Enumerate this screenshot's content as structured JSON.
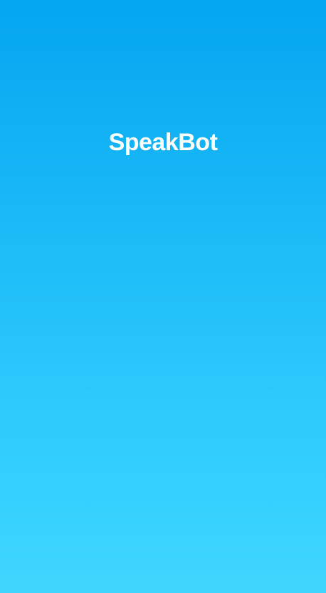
{
  "app": {
    "title": "SpeakBot"
  },
  "colors": {
    "gradient_top": "#04A6F0",
    "gradient_bottom": "#3FD6FF",
    "title_text": "#FFFFFF"
  }
}
